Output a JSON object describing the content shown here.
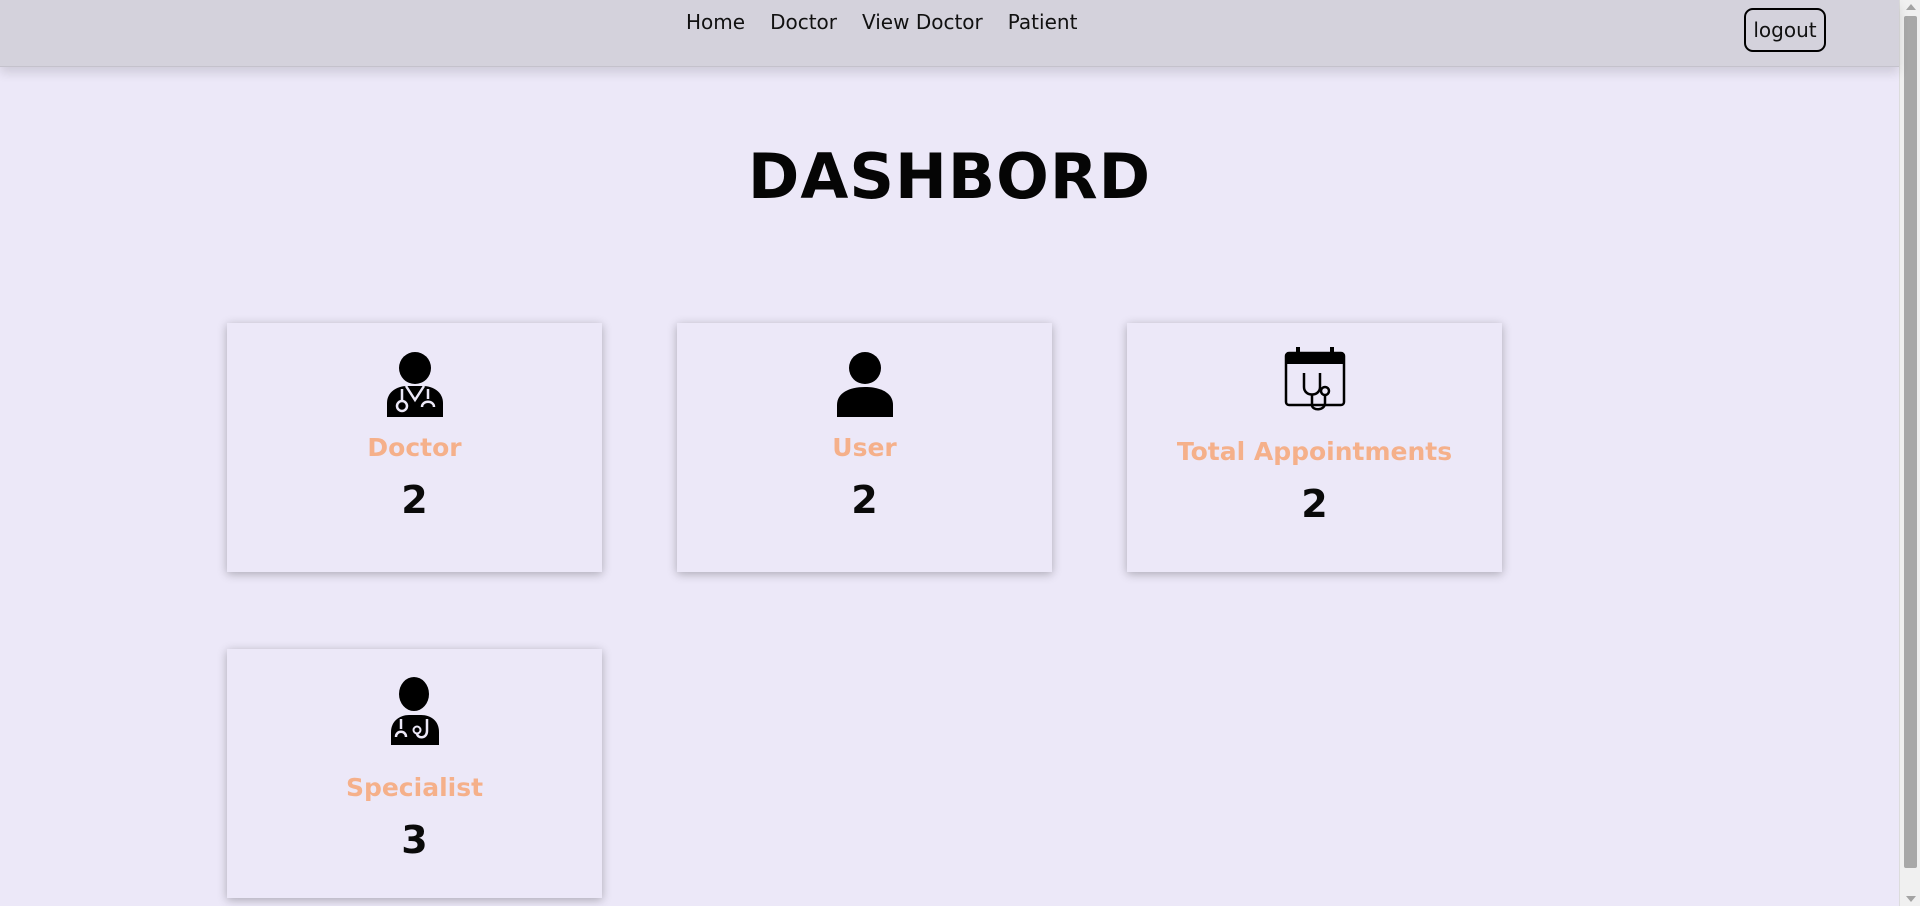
{
  "nav": {
    "items": [
      {
        "label": "Home"
      },
      {
        "label": "Doctor"
      },
      {
        "label": "View Doctor"
      },
      {
        "label": "Patient"
      }
    ],
    "logout_label": "logout"
  },
  "page": {
    "title": "DASHBORD"
  },
  "cards": [
    {
      "label": "Doctor",
      "value": "2",
      "icon": "doctor-icon"
    },
    {
      "label": "User",
      "value": "2",
      "icon": "user-icon"
    },
    {
      "label": "Total Appointments",
      "value": "2",
      "icon": "calendar-stethoscope-icon"
    },
    {
      "label": "Specialist",
      "value": "3",
      "icon": "specialist-icon"
    }
  ],
  "colors": {
    "background": "#ece8f8",
    "navbar": "#d4d2dc",
    "card_label": "#f5b08a",
    "text": "#0a0a0a"
  }
}
